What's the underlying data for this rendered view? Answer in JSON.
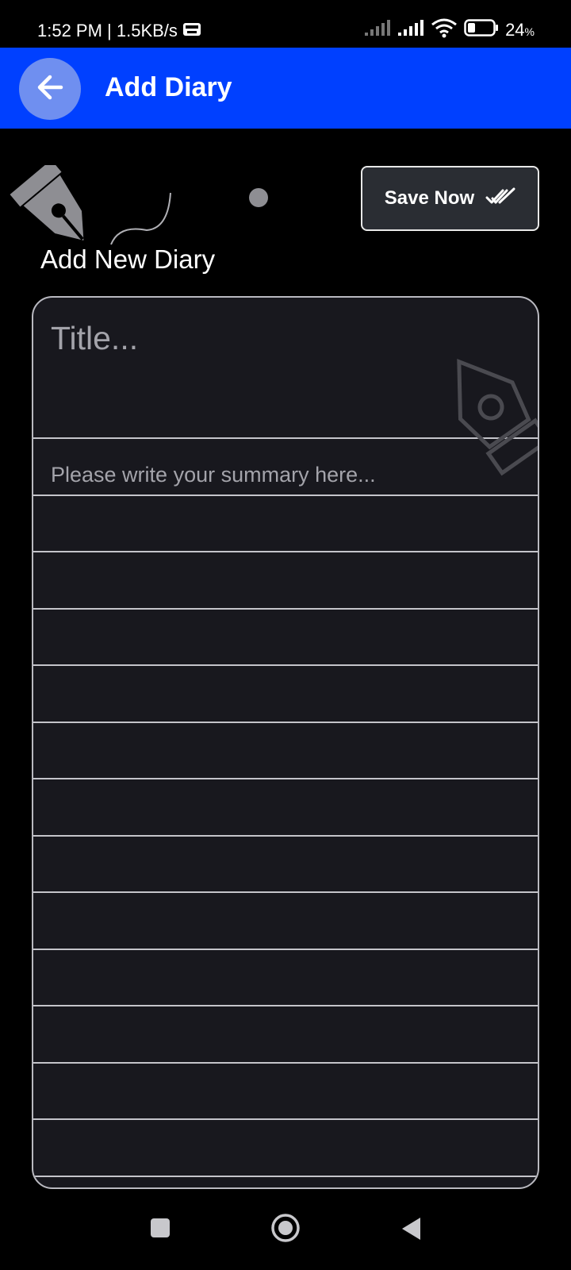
{
  "status_bar": {
    "time_speed": "1:52 PM | 1.5KB/s",
    "battery_percent": "24",
    "battery_unit": "%",
    "icons": [
      "hd-badge-icon",
      "signal-icon",
      "signal-icon",
      "wifi-icon",
      "battery-icon"
    ]
  },
  "app_bar": {
    "title": "Add Diary",
    "back_icon": "arrow-left-icon",
    "color": "#0040ff"
  },
  "header": {
    "save_label": "Save Now",
    "save_icon": "double-check-icon",
    "section_title": "Add New Diary"
  },
  "form": {
    "title_placeholder": "Title...",
    "summary_placeholder": "Please write your summary here..."
  },
  "nav_bar": {
    "icons": [
      "recents-square-icon",
      "home-circle-icon",
      "back-triangle-icon"
    ]
  }
}
